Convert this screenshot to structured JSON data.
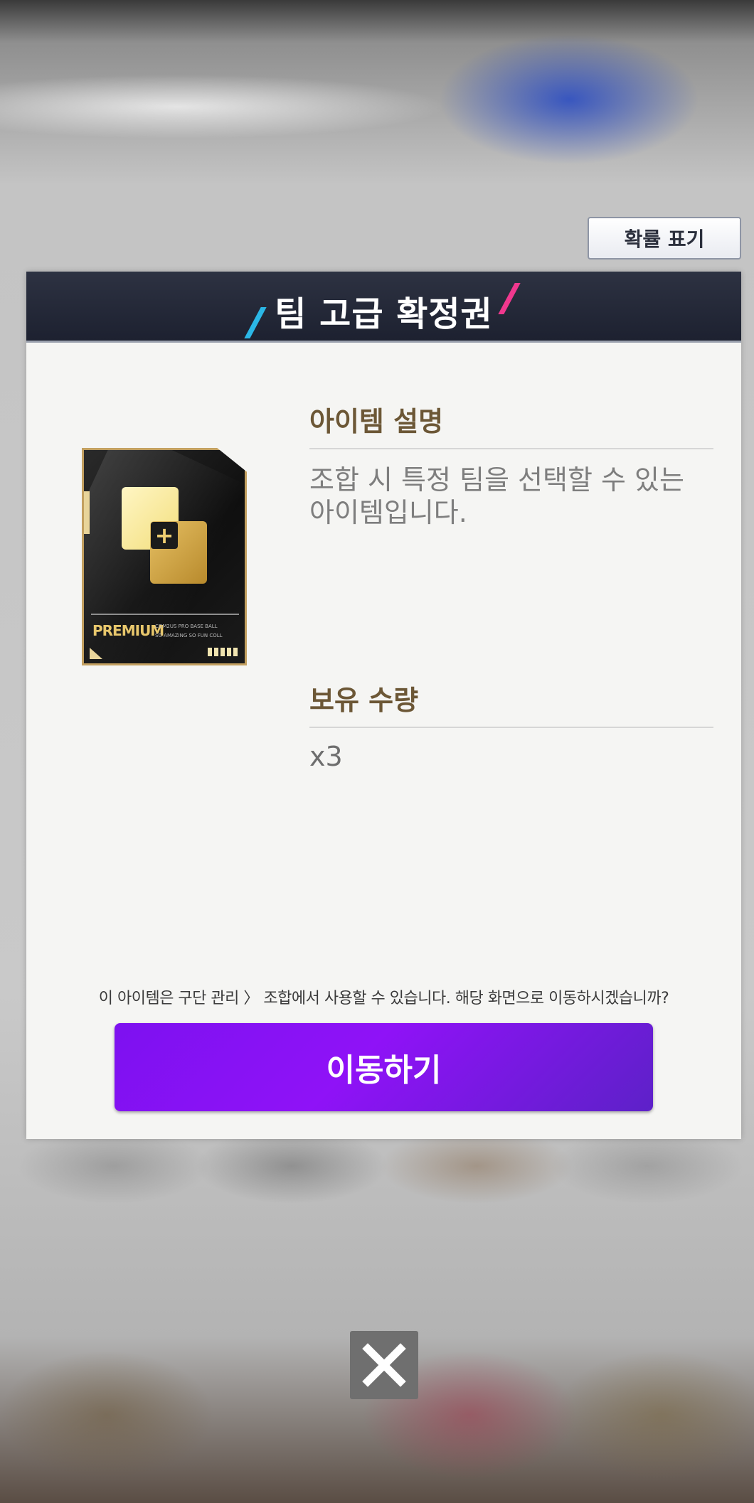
{
  "header_button": {
    "label": "확률 표기"
  },
  "dialog": {
    "title": "팀 고급 확정권",
    "item_card": {
      "premium_label": "PREMIUM",
      "fine_print_line1": "COM2US PRO BASE BALL",
      "fine_print_line2": "SO AMAZING SO FUN COLL"
    },
    "description": {
      "heading": "아이템 설명",
      "text": "조합 시 특정 팀을 선택할 수 있는 아이템입니다."
    },
    "quantity": {
      "heading": "보유 수량",
      "value": "x3"
    },
    "notice": "이 아이템은 구단 관리 〉 조합에서 사용할 수 있습니다. 해당 화면으로 이동하시겠습니까?",
    "move_button": {
      "label": "이동하기"
    }
  },
  "close_button": {
    "icon": "close-icon"
  },
  "colors": {
    "header_bg": "#1d2130",
    "accent_purple": "#8f12f7",
    "accent_blue": "#2bb7e6",
    "accent_pink": "#f0388e",
    "heading_brown": "#6c5736"
  }
}
